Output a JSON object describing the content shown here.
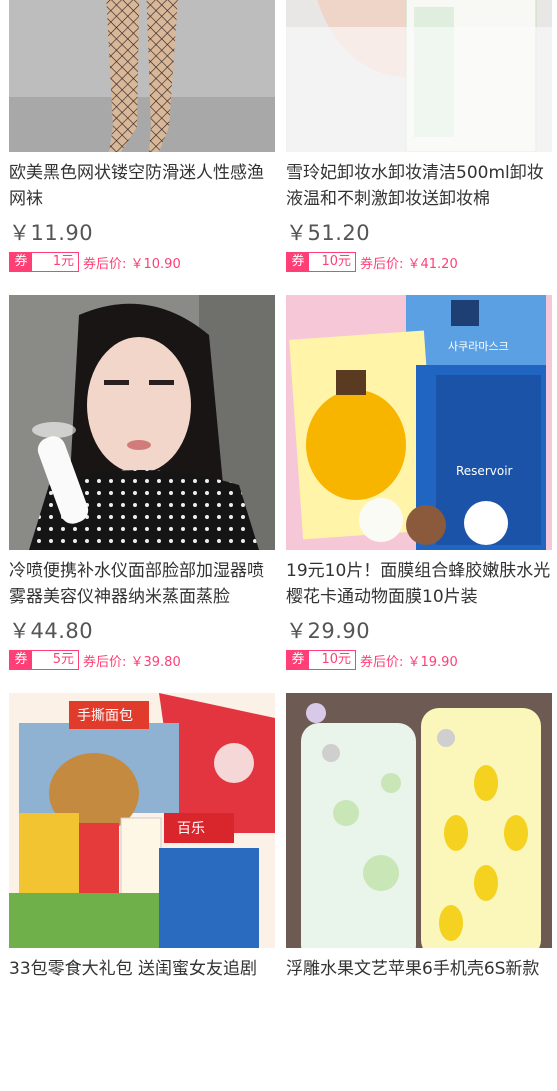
{
  "products": [
    {
      "title": "欧美黑色网状镂空防滑迷人性感渔网袜",
      "price": "￥11.90",
      "coupon_label": "券",
      "coupon_value": "1元",
      "after_price": "券后价: ￥10.90",
      "image_icon": "fishnet-stockings-photo"
    },
    {
      "title": "雪玲妃卸妆水卸妆清洁500ml卸妆液温和不刺激卸妆送卸妆棉",
      "price": "￥51.20",
      "coupon_label": "券",
      "coupon_value": "10元",
      "after_price": "券后价: ￥41.20",
      "image_icon": "makeup-remover-photo"
    },
    {
      "title": "冷喷便携补水仪面部脸部加湿器喷雾器美容仪神器纳米蒸面蒸脸",
      "price": "￥44.80",
      "coupon_label": "券",
      "coupon_value": "5元",
      "after_price": "券后价: ￥39.80",
      "image_icon": "face-mist-sprayer-photo"
    },
    {
      "title": "19元10片！面膜组合蜂胶嫩肤水光樱花卡通动物面膜10片装",
      "price": "￥29.90",
      "coupon_label": "券",
      "coupon_value": "10元",
      "after_price": "券后价: ￥19.90",
      "image_icon": "face-mask-set-photo",
      "image_text": [
        "사쿠라마스크",
        "Reservoir"
      ]
    },
    {
      "title": "33包零食大礼包 送闺蜜女友追剧",
      "price": "",
      "coupon_label": "",
      "coupon_value": "",
      "after_price": "",
      "image_icon": "snack-gift-box-photo",
      "image_text": [
        "手撕面包",
        "百乐"
      ]
    },
    {
      "title": "浮雕水果文艺苹果6手机壳6S新款",
      "price": "",
      "coupon_label": "",
      "coupon_value": "",
      "after_price": "",
      "image_icon": "phone-case-photo"
    }
  ]
}
